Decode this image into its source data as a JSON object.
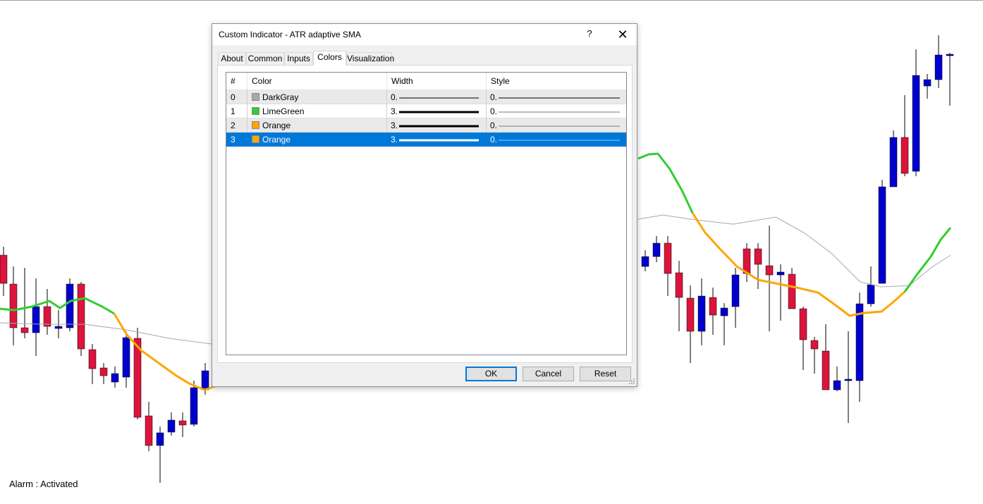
{
  "dialog": {
    "title": "Custom Indicator - ATR adaptive SMA",
    "help_label": "?",
    "close_label": "✕",
    "tabs": [
      {
        "label": "About"
      },
      {
        "label": "Common"
      },
      {
        "label": "Inputs"
      },
      {
        "label": "Colors",
        "active": true
      },
      {
        "label": "Visualization"
      }
    ],
    "grid": {
      "headers": {
        "index": "#",
        "color": "Color",
        "width": "Width",
        "style": "Style"
      },
      "rows": [
        {
          "index": "0",
          "color_name": "DarkGray",
          "color_hex": "#a9a9a9",
          "width": "0.",
          "style": "0."
        },
        {
          "index": "1",
          "color_name": "LimeGreen",
          "color_hex": "#32cd32",
          "width": "3.",
          "style": "0."
        },
        {
          "index": "2",
          "color_name": "Orange",
          "color_hex": "#ffa500",
          "width": "3.",
          "style": "0."
        },
        {
          "index": "3",
          "color_name": "Orange",
          "color_hex": "#ffa500",
          "width": "3.",
          "style": "0.",
          "selected": true
        }
      ]
    },
    "buttons": {
      "ok": "OK",
      "cancel": "Cancel",
      "reset": "Reset"
    }
  },
  "chart": {
    "status_text": "Alarm : Activated",
    "bull_color": "#0000cd",
    "bear_color": "#dc143c",
    "ma_up_color": "#32cd32",
    "ma_down_color": "#ffa500",
    "slow_ma_color": "#a9a9a9"
  }
}
